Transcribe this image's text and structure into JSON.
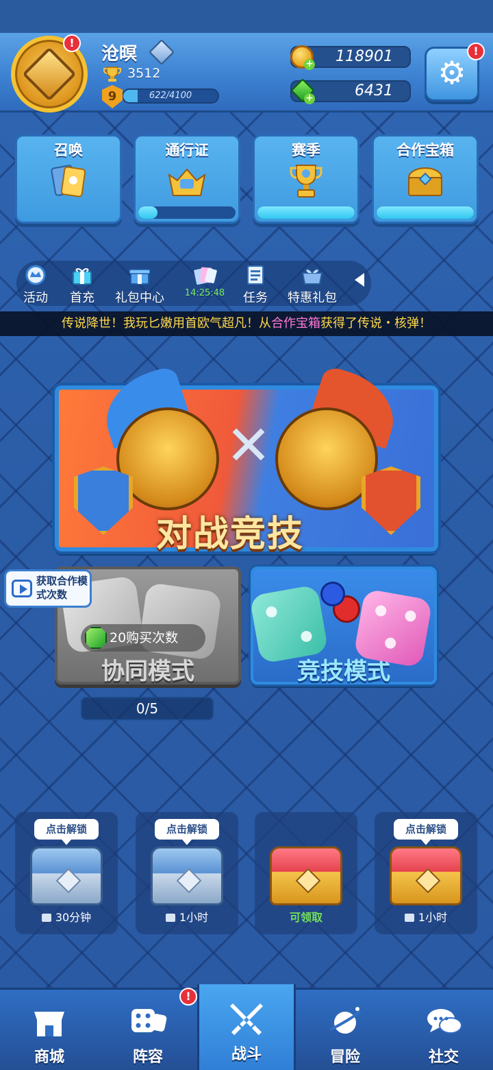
{
  "player": {
    "name": "沧暝",
    "trophies": "3512",
    "level": "9",
    "xp_text": "622/4100",
    "xp_progress": 0.15,
    "avatar_badge": "!"
  },
  "currency": {
    "coins": "118901",
    "gems": "6431",
    "plus": "+"
  },
  "settings": {
    "badge": "!",
    "icon": "gear-icon"
  },
  "tiles": [
    {
      "title": "召唤",
      "icon": "summon-cards-icon",
      "progress": null
    },
    {
      "title": "通行证",
      "icon": "pass-crown-icon",
      "progress": 0.2
    },
    {
      "title": "赛季",
      "icon": "season-trophy-icon",
      "progress": 1.0
    },
    {
      "title": "合作宝箱",
      "icon": "coop-chest-icon",
      "progress": 1.0
    }
  ],
  "strip": [
    {
      "label": "活动",
      "icon": "event-icon"
    },
    {
      "label": "首充",
      "icon": "first-recharge-icon"
    },
    {
      "label": "礼包中心",
      "icon": "gift-center-icon"
    },
    {
      "label": "14:25:48",
      "icon": "cards-timer-icon"
    },
    {
      "label": "任务",
      "icon": "task-icon"
    },
    {
      "label": "特惠礼包",
      "icon": "special-pack-icon"
    }
  ],
  "ticker": {
    "prefix": "传说降世！我玩匕嫩用首欧气超凡！从",
    "highlight": "合作宝箱",
    "suffix": "获得了传说・核弹！"
  },
  "battle": {
    "title": "对战竞技"
  },
  "modes": {
    "coop": {
      "title": "协同模式",
      "buy_text": "20购买次数",
      "count": "0/5",
      "hint": "获取合作模式次数"
    },
    "pvp": {
      "title": "竞技模式"
    }
  },
  "chests": [
    {
      "tag": "点击解锁",
      "status": "30分钟",
      "type": "silver",
      "locked": true
    },
    {
      "tag": "点击解锁",
      "status": "1小时",
      "type": "silver",
      "locked": true
    },
    {
      "tag": "",
      "status": "可领取",
      "type": "gold",
      "locked": false
    },
    {
      "tag": "点击解锁",
      "status": "1小时",
      "type": "gold",
      "locked": true
    }
  ],
  "nav": [
    {
      "label": "商城",
      "icon": "shop-icon"
    },
    {
      "label": "阵容",
      "icon": "dice-lineup-icon",
      "badge": "!"
    },
    {
      "label": "战斗",
      "icon": "crossed-swords-icon",
      "active": true
    },
    {
      "label": "冒险",
      "icon": "adventure-planet-icon"
    },
    {
      "label": "社交",
      "icon": "chat-bubbles-icon"
    }
  ],
  "colors": {
    "background": "#2a5da6",
    "header": "#3b7fd0",
    "accent_gold": "#f4c233",
    "ticker_highlight": "#ff7ad8",
    "ready_green": "#74e05a",
    "alert_red": "#e8303a"
  }
}
